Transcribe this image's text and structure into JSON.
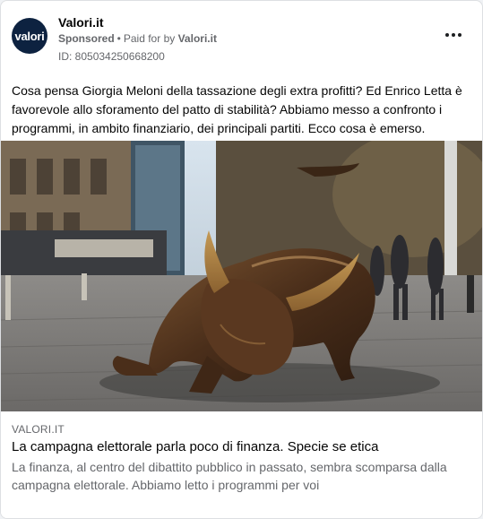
{
  "post": {
    "page_name": "Valori.it",
    "avatar_text": "valori",
    "sponsored_label": "Sponsored",
    "paid_for_prefix": "Paid for by",
    "paid_for_name": "Valori.it",
    "ad_id": "ID: 805034250668200",
    "body": "Cosa pensa Giorgia Meloni della tassazione degli extra profitti? Ed Enrico Letta è favorevole allo sforamento del patto di stabilità? Abbiamo messo a confronto i programmi, in ambito finanziario, dei principali partiti. Ecco cosa è emerso."
  },
  "link_preview": {
    "domain": "VALORI.IT",
    "title": "La campagna elettorale parla poco di finanza. Specie se etica",
    "description": "La finanza, al centro del dibattito pubblico in passato, sembra scomparsa dalla campagna elettorale. Abbiamo letto i programmi per voi"
  },
  "colors": {
    "avatar_bg": "#0d2240",
    "secondary_text": "#65676b",
    "card_border": "#dddfe2"
  },
  "icons": {
    "more": "more-horizontal-icon",
    "image": "charging-bull-photo"
  }
}
